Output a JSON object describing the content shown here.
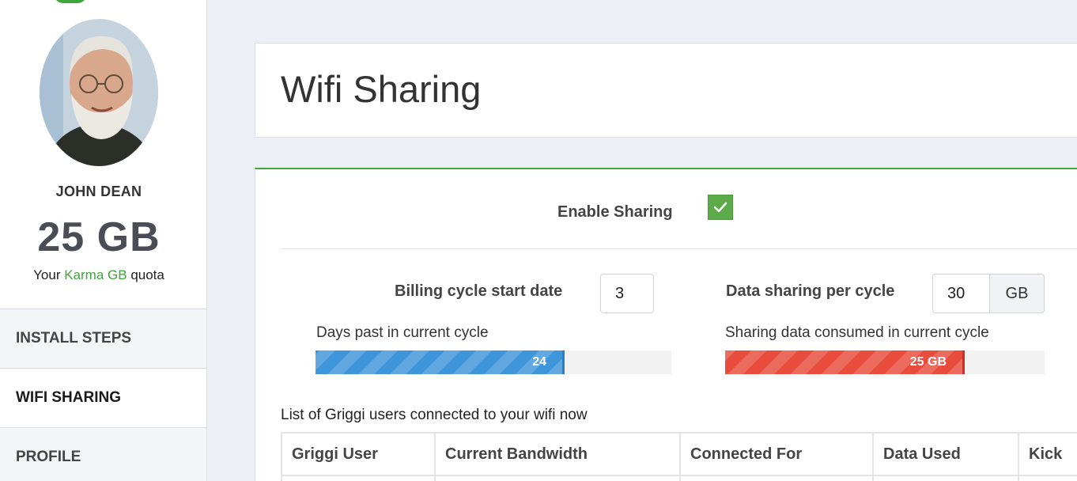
{
  "profile": {
    "name": "JOHN DEAN",
    "quota_value": "25 GB",
    "quota_prefix": "Your",
    "quota_brand": "Karma GB",
    "quota_suffix": "quota"
  },
  "nav": {
    "items": [
      {
        "label": "INSTALL STEPS"
      },
      {
        "label": "WIFI SHARING",
        "active": true
      },
      {
        "label": "PROFILE"
      }
    ]
  },
  "page": {
    "title": "Wifi Sharing"
  },
  "sharing": {
    "enable_label": "Enable Sharing",
    "enabled": true,
    "billing_label": "Billing cycle start date",
    "billing_value": "3",
    "data_label": "Data sharing per cycle",
    "data_value": "30",
    "data_unit": "GB",
    "days_label": "Days past in current cycle",
    "days_text": "24",
    "days_progress": 0.7,
    "consumed_label": "Sharing data consumed in current cycle",
    "consumed_text": "25 GB",
    "consumed_progress": 0.75
  },
  "users_list": {
    "caption": "List of Griggi users connected to your wifi now",
    "columns": [
      "Griggi User",
      "Current Bandwidth",
      "Connected For",
      "Data Used",
      "Kick"
    ]
  },
  "colors": {
    "brand_green": "#3fa63b",
    "progress_blue": "#3f95d9",
    "progress_red": "#e74c3c"
  }
}
